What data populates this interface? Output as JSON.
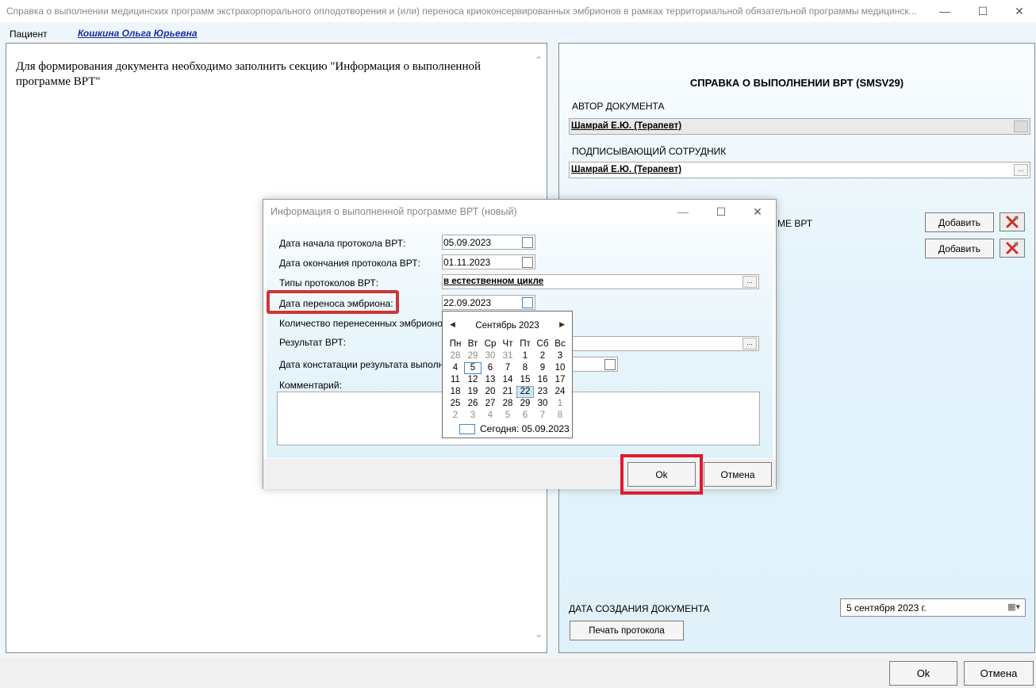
{
  "window": {
    "title": "Справка о выполнении медицинских программ экстракорпорального оплодотворения и (или) переноса криоконсервированных эмбрионов в рамках территориальной обязательной программы медицинск..."
  },
  "patient": {
    "label": "Пациент",
    "name": "Кошкина Ольга Юрьевна"
  },
  "left_panel": {
    "message": "Для формирования документа необходимо заполнить секцию \"Информация о выполненной программе ВРТ\""
  },
  "right_panel": {
    "title": "СПРАВКА О ВЫПОЛНЕНИИ ВРТ (SMSV29)",
    "author_label": "АВТОР ДОКУМЕНТА",
    "author_value": "Шамрай Е.Ю. (Терапевт)",
    "signer_label": "ПОДПИСЫВАЮЩИЙ СОТРУДНИК",
    "signer_value": "Шамрай Е.Ю. (Терапевт)",
    "section_label": "МЕ ВРТ",
    "add_button_1": "Добавить",
    "add_button_2": "Добавить",
    "created_label": "ДАТА СОЗДАНИЯ ДОКУМЕНТА",
    "created_value": "5 сентября 2023 г.",
    "print_button": "Печать протокола",
    "ellipsis": "..."
  },
  "bottom": {
    "ok": "Ok",
    "cancel": "Отмена"
  },
  "dialog": {
    "title": "Информация о выполненной программе ВРТ (новый)",
    "start_label": "Дата начала протокола ВРТ:",
    "start_value": "05.09.2023",
    "end_label": "Дата окончания протокола ВРТ:",
    "end_value": "01.11.2023",
    "types_label": "Типы протоколов ВРТ:",
    "types_value": "в естественном цикле",
    "transfer_label": "Дата переноса эмбриона:",
    "transfer_value": "22.09.2023",
    "count_label": "Количество перенесенных эмбрионо",
    "result_label": "Результат ВРТ:",
    "result_date_label": "Дата констатации результата выполне",
    "comment_label": "Комментарий:",
    "ok": "Ok",
    "cancel": "Отмена",
    "ellipsis": "..."
  },
  "calendar": {
    "month": "Сентябрь 2023",
    "weekdays": [
      "Пн",
      "Вт",
      "Ср",
      "Чт",
      "Пт",
      "Сб",
      "Вс"
    ],
    "days": [
      {
        "d": "28",
        "m": true
      },
      {
        "d": "29",
        "m": true
      },
      {
        "d": "30",
        "m": true
      },
      {
        "d": "31",
        "m": true
      },
      {
        "d": "1"
      },
      {
        "d": "2"
      },
      {
        "d": "3"
      },
      {
        "d": "4"
      },
      {
        "d": "5",
        "today": true
      },
      {
        "d": "6"
      },
      {
        "d": "7"
      },
      {
        "d": "8"
      },
      {
        "d": "9"
      },
      {
        "d": "10"
      },
      {
        "d": "11"
      },
      {
        "d": "12"
      },
      {
        "d": "13"
      },
      {
        "d": "14"
      },
      {
        "d": "15"
      },
      {
        "d": "16"
      },
      {
        "d": "17"
      },
      {
        "d": "18"
      },
      {
        "d": "19"
      },
      {
        "d": "20"
      },
      {
        "d": "21"
      },
      {
        "d": "22",
        "selected": true
      },
      {
        "d": "23"
      },
      {
        "d": "24"
      },
      {
        "d": "25"
      },
      {
        "d": "26"
      },
      {
        "d": "27"
      },
      {
        "d": "28"
      },
      {
        "d": "29"
      },
      {
        "d": "30"
      },
      {
        "d": "1",
        "m": true
      },
      {
        "d": "2",
        "m": true
      },
      {
        "d": "3",
        "m": true
      },
      {
        "d": "4",
        "m": true
      },
      {
        "d": "5",
        "m": true
      },
      {
        "d": "6",
        "m": true
      },
      {
        "d": "7",
        "m": true
      },
      {
        "d": "8",
        "m": true
      }
    ],
    "today_label": "Сегодня: 05.09.2023"
  },
  "colors": {
    "highlight": "#cf3535",
    "link": "#1a2fa0",
    "panel_bg": "#e4f3fb"
  }
}
